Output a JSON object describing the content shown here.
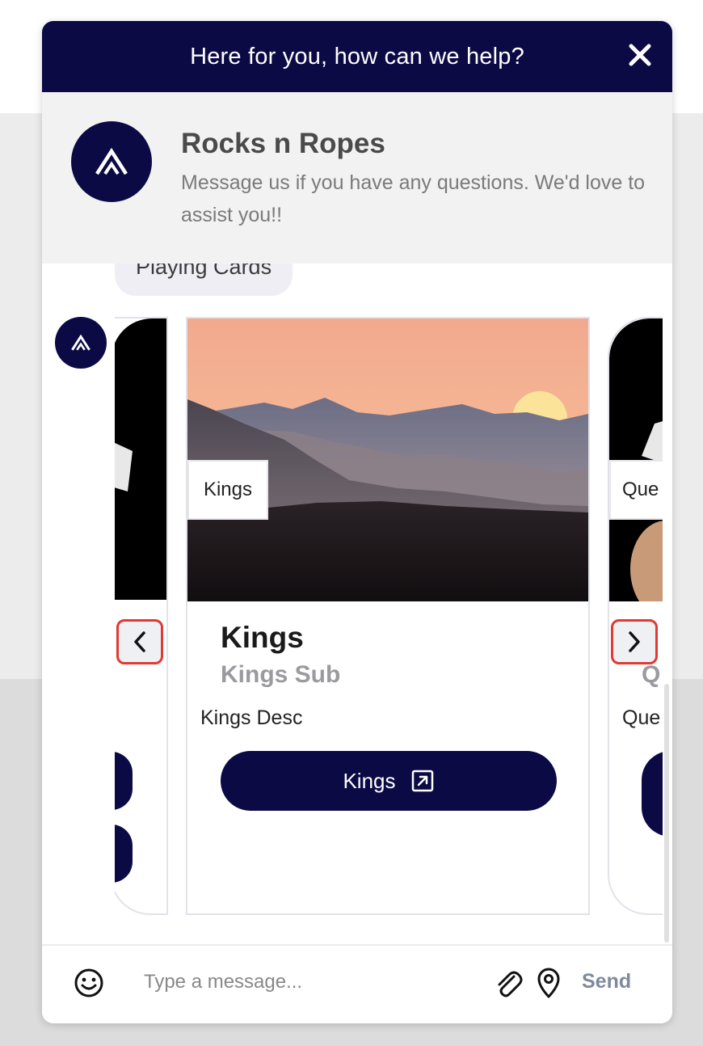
{
  "header": {
    "title": "Here for you, how can we help?",
    "close_icon": "close-icon"
  },
  "intro": {
    "name": "Rocks n Ropes",
    "message": "Message us if you have any questions. We'd love to assist you!!"
  },
  "chip": {
    "label": "Playing Cards"
  },
  "carousel": {
    "prev_icon": "chevron-left-icon",
    "next_icon": "chevron-right-icon",
    "current": {
      "image_tag": "Kings",
      "title": "Kings",
      "subtitle": "Kings Sub",
      "description": "Kings Desc",
      "button_label": "Kings",
      "button_icon": "external-link-icon"
    },
    "next": {
      "image_tag": "Que",
      "subtitle": "Q",
      "description": "Que"
    }
  },
  "composer": {
    "placeholder": "Type a message...",
    "send_label": "Send",
    "emoji_icon": "smiley-icon",
    "attach_icon": "paperclip-icon",
    "location_icon": "location-pin-icon"
  },
  "colors": {
    "brand_navy": "#0b0a45",
    "highlight_red": "#e03a32",
    "send_gray": "#7f8a9c"
  }
}
